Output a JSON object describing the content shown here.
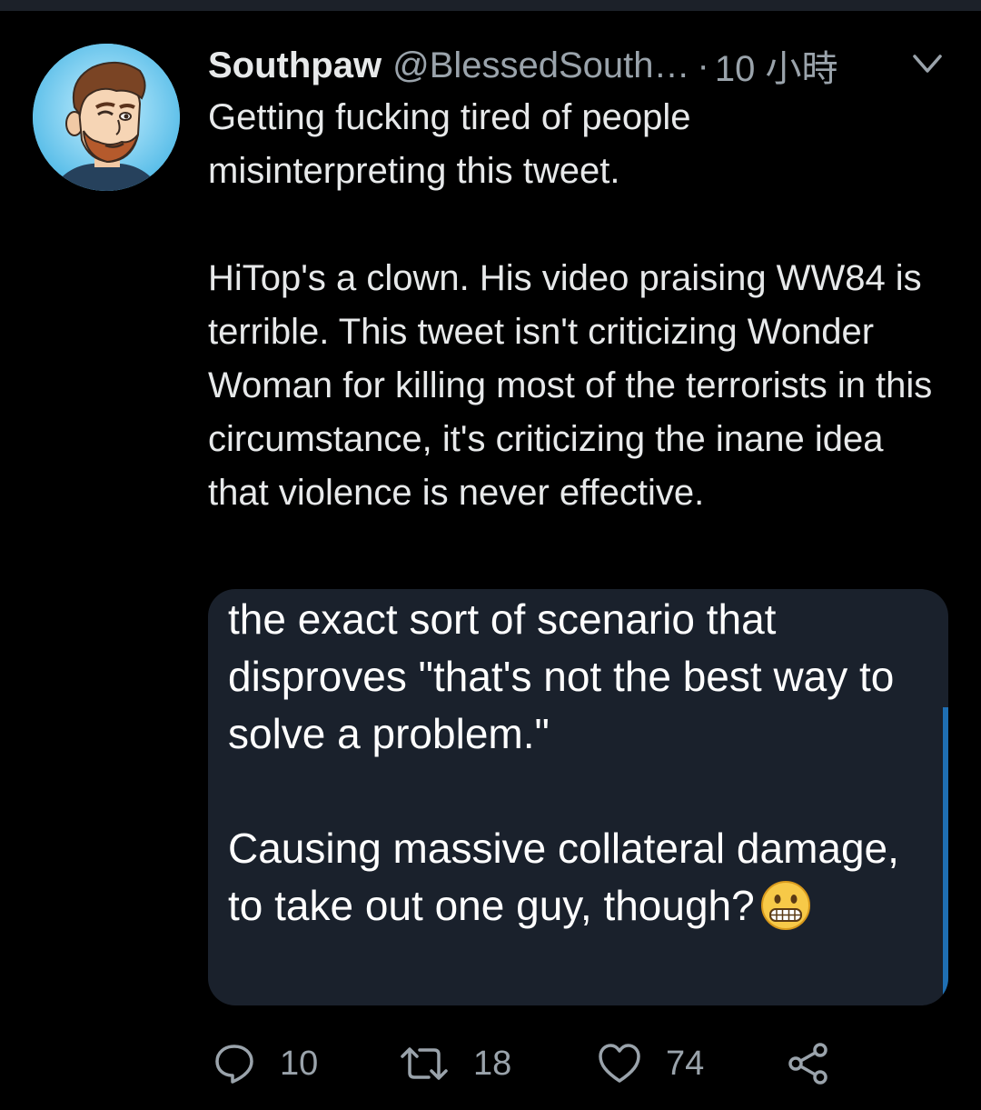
{
  "tweet": {
    "display_name": "Southpaw",
    "handle": "@BlessedSouth…",
    "separator": "·",
    "time": "10 小時",
    "text_paragraphs": [
      "Getting fucking tired of people misinterpreting this tweet.",
      "HiTop's a clown. His video praising WW84 is terrible. This tweet isn't criticizing Wonder Woman for killing most of the terrorists in this circumstance, it's criticizing the inane idea that violence is never effective."
    ]
  },
  "attached_image": {
    "paragraph_1": "the exact sort of scenario that disproves \"that's not the best way to solve a problem.\"",
    "paragraph_2": "Causing massive collateral damage, to take out one guy, though?",
    "emoji": "grimacing-face-emoji"
  },
  "actions": {
    "reply_count": "10",
    "retweet_count": "18",
    "like_count": "74"
  },
  "icons": {
    "menu": "chevron-down-icon",
    "reply": "reply-icon",
    "retweet": "retweet-icon",
    "like": "heart-icon",
    "share": "share-icon"
  },
  "colors": {
    "background": "#000000",
    "secondary_text": "#9aa3ab",
    "image_card_background": "#1a212c",
    "scroll_indicator": "#1f6fb3"
  }
}
